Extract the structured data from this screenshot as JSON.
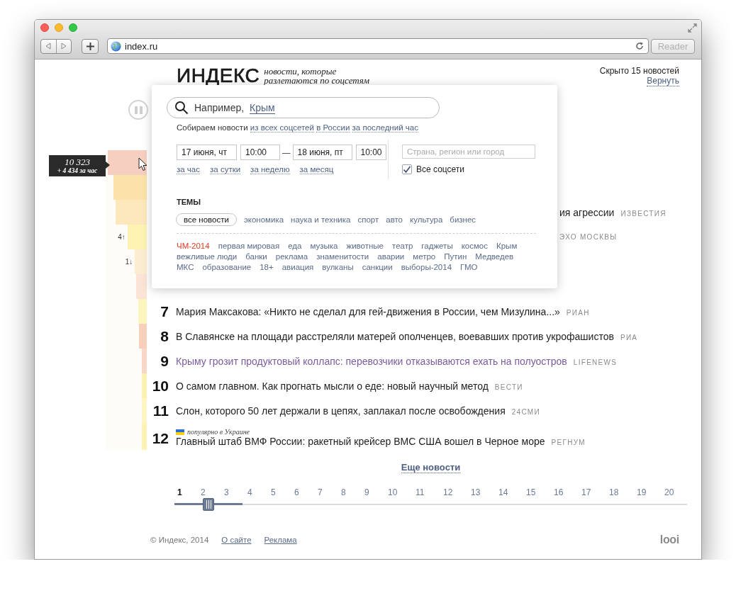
{
  "browser": {
    "url": "index.ru",
    "reader_button": {
      "label": "Reader",
      "disabled": true
    }
  },
  "header": {
    "logo": "ИНДЕКС",
    "tagline": "новости, которые разлетаются по соцсетям",
    "hidden_note": "Скрыто 15 новостей",
    "restore_link": "Вернуть"
  },
  "tooltip": {
    "count": "10 323",
    "delta": "+ 4 434 за час"
  },
  "news": [
    {
      "kind": "covered",
      "bar": {
        "color": "#f7cfc0",
        "level": 0.95
      }
    },
    {
      "kind": "covered",
      "bar": {
        "color": "#fbe2a8",
        "level": 0.81
      }
    },
    {
      "kind": "covered",
      "fragment": "ия агрессии",
      "source": "ИЗВЕСТИЯ",
      "bar": {
        "color": "#fde7bc",
        "level": 0.76
      }
    },
    {
      "kind": "covered",
      "source": "ЭХО МОСКВЫ",
      "trend": "4↑",
      "bar": {
        "color": "#fef3b3",
        "level": 0.47
      }
    },
    {
      "kind": "covered",
      "trend": "1↓",
      "bar": {
        "color": "#fdedd0",
        "level": 0.29
      }
    },
    {
      "kind": "covered",
      "bar": {
        "color": "#fbe4d6",
        "level": 0.26
      }
    },
    {
      "kind": "story",
      "rank": "7",
      "headline": "Мария Максакова: «Никто не сделал для гей-движения в России, чем Мизулина...»",
      "source": "РИАН",
      "visited": false,
      "bar": {
        "color": "#fdf5c0",
        "level": 0.21
      }
    },
    {
      "kind": "story",
      "rank": "8",
      "headline": "В Славянске на площади расстреляли матерей ополченцев, воевавших против укрофашистов",
      "source": "РИА",
      "visited": false,
      "bar": {
        "color": "#f8cfbb",
        "level": 0.19
      }
    },
    {
      "kind": "story",
      "rank": "9",
      "headline": "Крыму грозит продуктовый коллапс: перевозчики отказываются ехать на полуостров",
      "source": "LIFENEWS",
      "visited": true,
      "bar": {
        "color": "#f8d6c8",
        "level": 0.12
      }
    },
    {
      "kind": "story",
      "rank": "10",
      "headline": "О самом главном. Как прогнать мысли о еде: новый научный метод",
      "source": "ВЕСТИ",
      "visited": false,
      "bar": {
        "color": "#fdf0b0",
        "level": 0.12
      }
    },
    {
      "kind": "story",
      "rank": "11",
      "headline": "Слон, которого 50 лет держали в цепях, заплакал после освобождения",
      "source": "24СМИ",
      "visited": false,
      "bar": {
        "color": "#fef5c2",
        "level": 0.12
      }
    },
    {
      "kind": "story",
      "rank": "12",
      "popular_note": "популярно в Украине",
      "headline": "Главный штаб ВМФ России: ракетный крейсер ВМС США вошел в Черное море",
      "source": "РЕГНУМ",
      "visited": false,
      "bar": {
        "color": "#fef3b5",
        "level": 0.12
      }
    }
  ],
  "filter": {
    "search": {
      "placeholder": "Например,",
      "example": "Крым"
    },
    "note": {
      "text": "Собираем новости",
      "links": [
        "из всех соцсетей",
        "в России",
        "за последний час"
      ]
    },
    "date_from": "17 июня, чт",
    "time_from": "10:00",
    "separator": "—",
    "date_to": "18 июня, пт",
    "time_to": "10:00",
    "quick_ranges": [
      "за час",
      "за сутки",
      "за неделю",
      "за месяц"
    ],
    "location": {
      "placeholder": "Страна, регион или город"
    },
    "all_networks": {
      "label": "Все соцсети",
      "checked": true
    },
    "topics_title": "ТЕМЫ",
    "topics": [
      {
        "label": "все новости",
        "selected": true
      },
      {
        "label": "экономика",
        "selected": false
      },
      {
        "label": "наука и техника",
        "selected": false
      },
      {
        "label": "спорт",
        "selected": false
      },
      {
        "label": "авто",
        "selected": false
      },
      {
        "label": "культура",
        "selected": false
      },
      {
        "label": "бизнес",
        "selected": false
      }
    ],
    "tag_rows": [
      [
        {
          "label": "ЧМ-2014",
          "highlighted": true
        },
        {
          "label": "первая мировая",
          "highlighted": false
        },
        {
          "label": "еда",
          "highlighted": false
        },
        {
          "label": "музыка",
          "highlighted": false
        },
        {
          "label": "животные",
          "highlighted": false
        },
        {
          "label": "театр",
          "highlighted": false
        },
        {
          "label": "гаджеты",
          "highlighted": false
        },
        {
          "label": "космос",
          "highlighted": false
        },
        {
          "label": "Крым",
          "highlighted": false
        }
      ],
      [
        {
          "label": "вежливые люди",
          "highlighted": false
        },
        {
          "label": "банки",
          "highlighted": false
        },
        {
          "label": "реклама",
          "highlighted": false
        },
        {
          "label": "знаменитости",
          "highlighted": false
        },
        {
          "label": "аварии",
          "highlighted": false
        },
        {
          "label": "метро",
          "highlighted": false
        },
        {
          "label": "Путин",
          "highlighted": false
        },
        {
          "label": "Медведев",
          "highlighted": false
        }
      ],
      [
        {
          "label": "МКС",
          "highlighted": false
        },
        {
          "label": "образование",
          "highlighted": false
        },
        {
          "label": "18+",
          "highlighted": false
        },
        {
          "label": "авиация",
          "highlighted": false
        },
        {
          "label": "вулканы",
          "highlighted": false
        },
        {
          "label": "санкции",
          "highlighted": false
        },
        {
          "label": "выборы-2014",
          "highlighted": false
        },
        {
          "label": "ГМО",
          "highlighted": false
        }
      ]
    ]
  },
  "more_link": "Еще новости",
  "pages": [
    {
      "label": "1",
      "selected": true
    },
    {
      "label": "2",
      "selected": false
    },
    {
      "label": "3",
      "selected": false
    },
    {
      "label": "4",
      "selected": false
    },
    {
      "label": "5",
      "selected": false
    },
    {
      "label": "6",
      "selected": false
    },
    {
      "label": "7",
      "selected": false
    },
    {
      "label": "8",
      "selected": false
    },
    {
      "label": "9",
      "selected": false
    },
    {
      "label": "10",
      "selected": false
    },
    {
      "label": "11",
      "selected": false
    },
    {
      "label": "12",
      "selected": false
    },
    {
      "label": "13",
      "selected": false
    },
    {
      "label": "14",
      "selected": false
    },
    {
      "label": "15",
      "selected": false
    },
    {
      "label": "16",
      "selected": false
    },
    {
      "label": "17",
      "selected": false
    },
    {
      "label": "18",
      "selected": false
    },
    {
      "label": "19",
      "selected": false
    },
    {
      "label": "20",
      "selected": false
    }
  ],
  "page_slider": {
    "level": 0.133
  },
  "footer": {
    "copyright": "© Индекс, 2014",
    "links": [
      "О сайте",
      "Реклама"
    ],
    "brand": "looi"
  }
}
